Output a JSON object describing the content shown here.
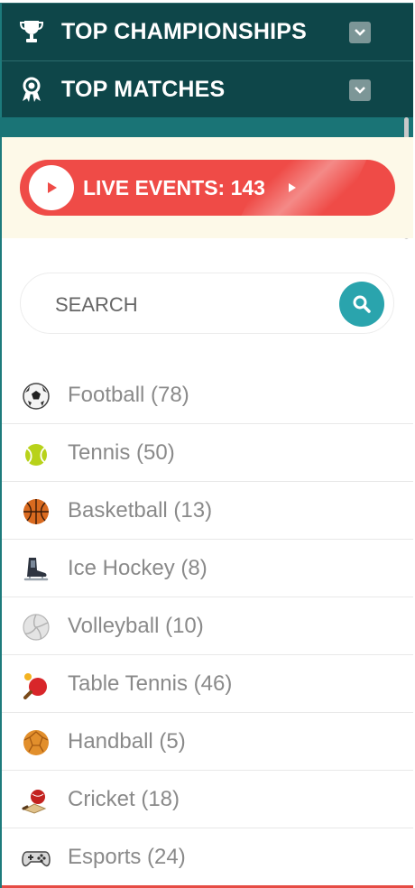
{
  "menu": {
    "top_championships": "TOP CHAMPIONSHIPS",
    "top_matches": "TOP MATCHES"
  },
  "live": {
    "label": "LIVE EVENTS: 143"
  },
  "search": {
    "placeholder": "SEARCH"
  },
  "sports": [
    {
      "label": "Football (78)",
      "icon": "football-icon"
    },
    {
      "label": "Tennis (50)",
      "icon": "tennis-ball-icon"
    },
    {
      "label": "Basketball (13)",
      "icon": "basketball-icon"
    },
    {
      "label": "Ice Hockey (8)",
      "icon": "ice-skate-icon"
    },
    {
      "label": "Volleyball (10)",
      "icon": "volleyball-icon"
    },
    {
      "label": "Table Tennis (46)",
      "icon": "ping-pong-icon"
    },
    {
      "label": "Handball (5)",
      "icon": "handball-icon"
    },
    {
      "label": "Cricket (18)",
      "icon": "cricket-icon"
    },
    {
      "label": "Esports (24)",
      "icon": "gamepad-icon"
    }
  ],
  "colors": {
    "header_bg": "#0e4649",
    "accent_teal": "#2aa4ad",
    "live_red": "#ef4b47",
    "live_bg": "#fdf9e8"
  }
}
